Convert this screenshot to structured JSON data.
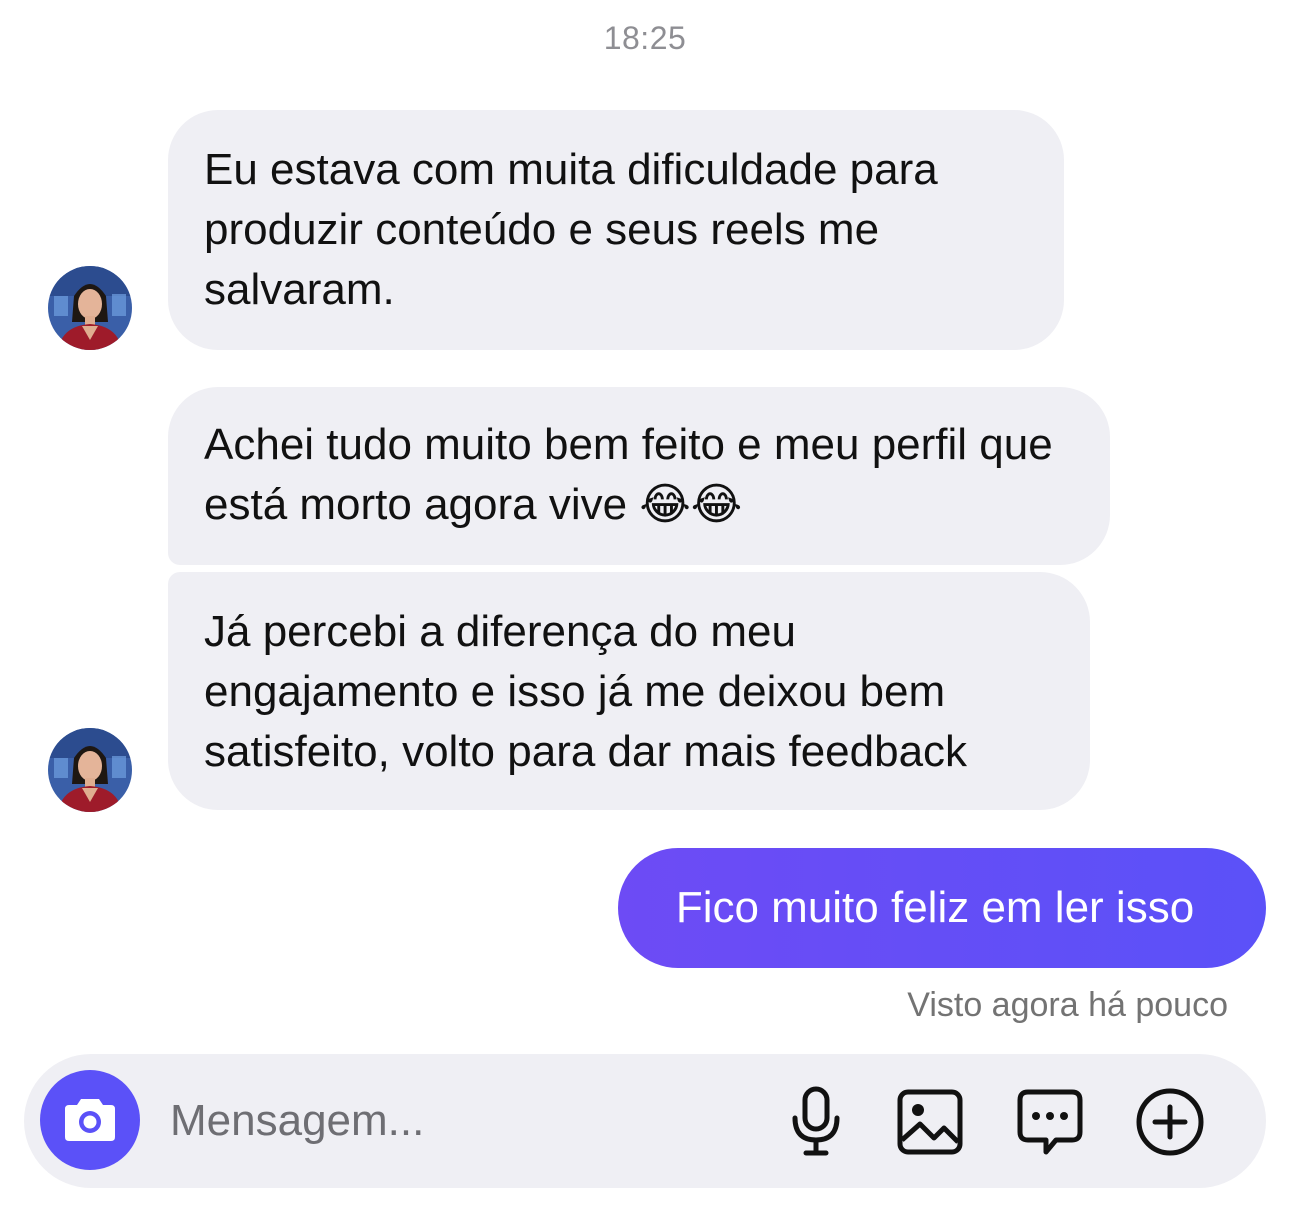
{
  "timestamp": "18:25",
  "messages": [
    {
      "text": "Eu estava com muita dificuldade para produzir conteúdo e seus reels me salvaram."
    },
    {
      "text": "Achei tudo muito bem feito e meu perfil que está morto agora vive 😂😂"
    },
    {
      "text": "Já percebi a diferença do meu engajamento e isso já me deixou bem satisfeito, volto para dar mais feedback"
    }
  ],
  "sent_message": {
    "text": "Fico muito feliz em ler isso"
  },
  "seen_status": "Visto agora há pouco",
  "composer": {
    "placeholder": "Mensagem...",
    "icons": [
      "camera-icon",
      "microphone-icon",
      "image-icon",
      "sticker-chat-icon",
      "plus-icon"
    ]
  },
  "colors": {
    "received_bubble": "#efeff4",
    "sent_bubble": "#5b51f8",
    "camera_button": "#5b51f8"
  }
}
